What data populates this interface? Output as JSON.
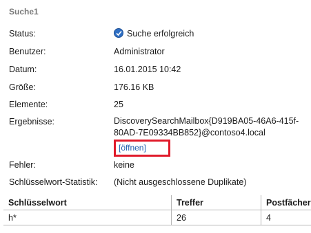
{
  "section_title": "Suche1",
  "fields": {
    "status": {
      "label": "Status:",
      "value": "Suche erfolgreich",
      "icon": "check-circle-icon"
    },
    "user": {
      "label": "Benutzer:",
      "value": "Administrator"
    },
    "date": {
      "label": "Datum:",
      "value": "16.01.2015 10:42"
    },
    "size": {
      "label": "Größe:",
      "value": "176.16 KB"
    },
    "items": {
      "label": "Elemente:",
      "value": "25"
    },
    "results": {
      "label": "Ergebnisse:",
      "value": "DiscoverySearchMailbox{D919BA05-46A6-415f-80AD-7E09334BB852}@contoso4.local",
      "link": "[öffnen]"
    },
    "errors": {
      "label": "Fehler:",
      "value": "keine"
    },
    "keyword_stats": {
      "label": "Schlüsselwort-Statistik:",
      "value": "(Nicht ausgeschlossene Duplikate)"
    }
  },
  "keyword_table": {
    "headers": [
      "Schlüsselwort",
      "Treffer",
      "Postfächer"
    ],
    "rows": [
      [
        "h*",
        "26",
        "4"
      ]
    ]
  },
  "colors": {
    "highlight_border": "#e01a2a",
    "link": "#1f5fae",
    "check_icon": "#2f6fc4"
  }
}
